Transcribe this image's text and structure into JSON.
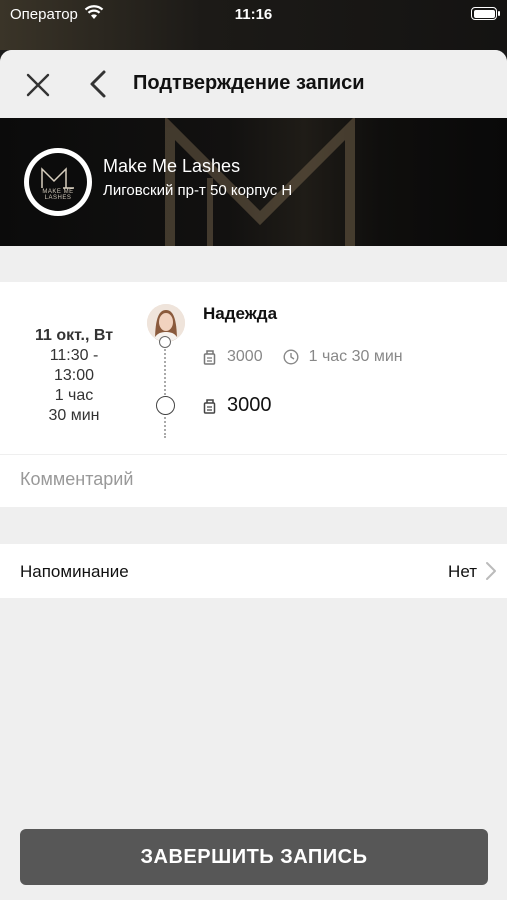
{
  "status_bar": {
    "carrier": "Оператор",
    "time": "11:16"
  },
  "nav": {
    "title": "Подтверждение записи"
  },
  "studio": {
    "name": "Make Me Lashes",
    "address": "Лиговский пр-т 50 корпус Н",
    "logo_text": "MAKE ME LASHES"
  },
  "appointment": {
    "date": "11 окт., Вт",
    "time_range": "11:30 -\n13:00",
    "duration": "1 час\n30 мин",
    "master_name": "Надежда",
    "service_price": "3000",
    "service_duration": "1 час 30 мин",
    "total": "3000"
  },
  "comment": {
    "placeholder": "Комментарий"
  },
  "reminder": {
    "label": "Напоминание",
    "value": "Нет"
  },
  "submit": {
    "label": "ЗАВЕРШИТЬ ЗАПИСЬ"
  },
  "colors": {
    "submit_bg": "#575757",
    "sheet_bg": "#efefef",
    "banner_bg": "#0b0b0b"
  }
}
